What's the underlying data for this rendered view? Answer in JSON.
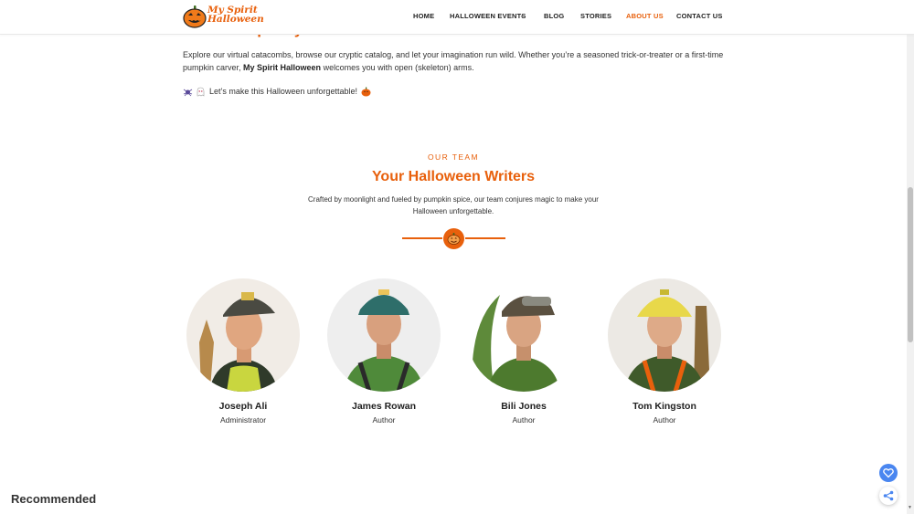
{
  "site": {
    "logo_alt": "My Spirit Halloween",
    "logo_line1": "My Spirit",
    "logo_line2": "Halloween"
  },
  "nav": {
    "items": [
      {
        "label": "HOME"
      },
      {
        "label": "HALLOWEEN EVENTS",
        "has_dropdown": true
      },
      {
        "label": "BLOG"
      },
      {
        "label": "STORIES"
      },
      {
        "label": "ABOUT US",
        "active": true
      },
      {
        "label": "CONTACT US"
      }
    ]
  },
  "intro": {
    "heading_partial": "Join the Spooky Fun",
    "paragraph_before": "Explore our virtual catacombs, browse our cryptic catalog, and let your imagination run wild. Whether you’re a seasoned trick-or-treater or a first-time pumpkin carver, ",
    "paragraph_bold": "My Spirit Halloween",
    "paragraph_after": " welcomes you with open (skeleton) arms.",
    "tagline": "Let’s make this Halloween unforgettable!"
  },
  "team": {
    "eyebrow": "OUR TEAM",
    "title": "Your Halloween Writers",
    "description": "Crafted by moonlight and fueled by pumpkin spice, our team conjures magic to make your Halloween unforgettable.",
    "members": [
      {
        "name": "Joseph Ali",
        "role": "Administrator"
      },
      {
        "name": "James Rowan",
        "role": "Author"
      },
      {
        "name": "Bili Jones",
        "role": "Author"
      },
      {
        "name": "Tom Kingston",
        "role": "Author"
      }
    ]
  },
  "footer": {
    "recommended": "Recommended"
  },
  "colors": {
    "accent": "#e8600c",
    "text": "#222222",
    "favorite_button": "#4a86f0"
  },
  "icons": {
    "logo": "pumpkin-logo-icon",
    "dropdown": "chevron-down-icon",
    "tagline_left": "spider-icon",
    "tagline_mid": "ghost-icon",
    "tagline_right": "pumpkin-icon",
    "divider": "pumpkin-badge-icon",
    "favorite": "heart-icon",
    "share": "share-icon"
  }
}
